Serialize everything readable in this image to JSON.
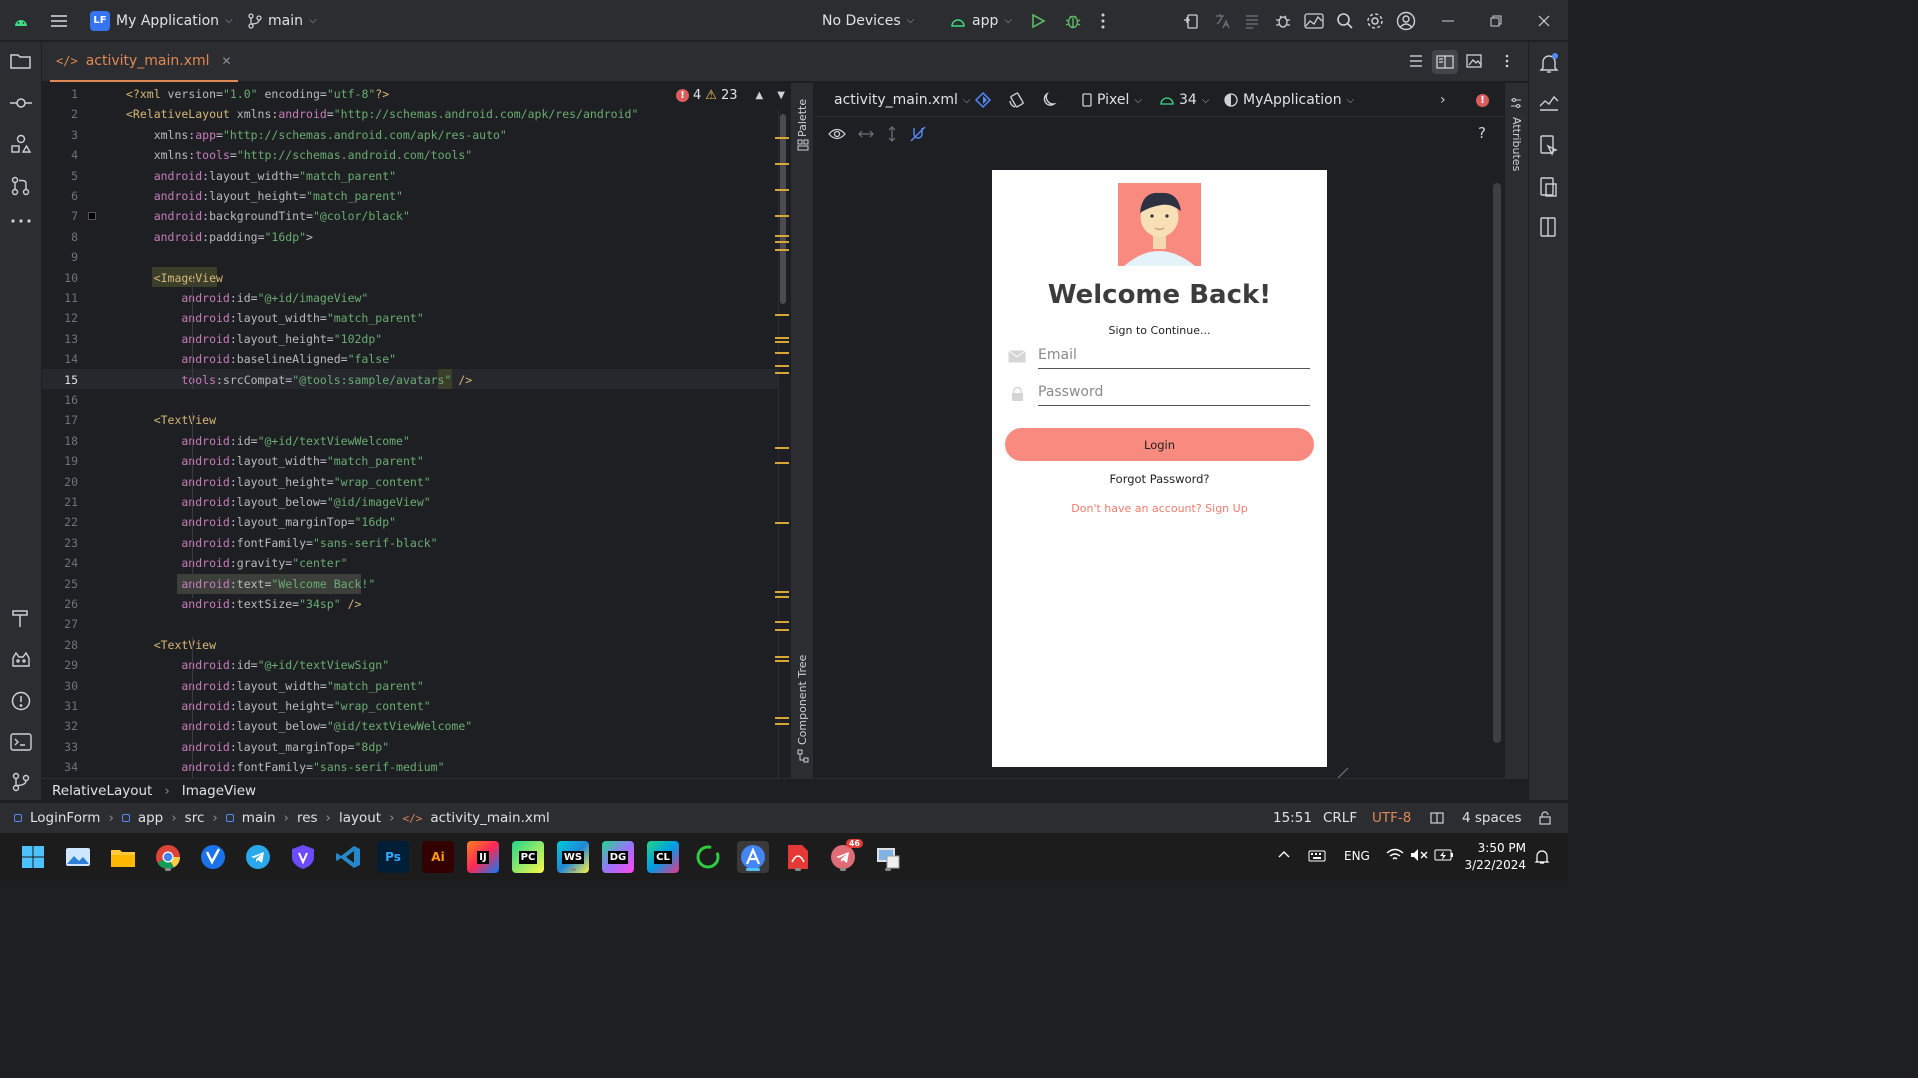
{
  "title_bar": {
    "project_badge": "LF",
    "project_name": "My Application",
    "branch": "main",
    "device": "No Devices",
    "run_config": "app",
    "accent_color": "#3574f0"
  },
  "tabs": [
    {
      "label": "activity_main.xml",
      "icon": "xml-code-icon"
    }
  ],
  "editor": {
    "errors": "4",
    "warnings": "23",
    "lines": [
      {
        "n": "1",
        "parts": [
          [
            "pi",
            "<?xml "
          ],
          [
            "attr",
            "version"
          ],
          [
            "pun",
            "="
          ],
          [
            "str",
            "\"1.0\""
          ],
          [
            "attr",
            " encoding"
          ],
          [
            "pun",
            "="
          ],
          [
            "str",
            "\"utf-8\""
          ],
          [
            "pi",
            "?>"
          ]
        ]
      },
      {
        "n": "2",
        "parts": [
          [
            "tag",
            "<RelativeLayout "
          ],
          [
            "attr",
            "xmlns:"
          ],
          [
            "ns",
            "android"
          ],
          [
            "pun",
            "="
          ],
          [
            "str",
            "\"http://schemas.android.com/apk/res/android\""
          ]
        ]
      },
      {
        "n": "3",
        "parts": [
          [
            "attr",
            "    xmlns:"
          ],
          [
            "ns",
            "app"
          ],
          [
            "pun",
            "="
          ],
          [
            "str",
            "\"http://schemas.android.com/apk/res-auto\""
          ]
        ]
      },
      {
        "n": "4",
        "parts": [
          [
            "attr",
            "    xmlns:"
          ],
          [
            "ns",
            "tools"
          ],
          [
            "pun",
            "="
          ],
          [
            "str",
            "\"http://schemas.android.com/tools\""
          ]
        ]
      },
      {
        "n": "5",
        "parts": [
          [
            "ns",
            "    android"
          ],
          [
            "attr",
            ":layout_width"
          ],
          [
            "pun",
            "="
          ],
          [
            "str",
            "\"match_parent\""
          ]
        ]
      },
      {
        "n": "6",
        "parts": [
          [
            "ns",
            "    android"
          ],
          [
            "attr",
            ":layout_height"
          ],
          [
            "pun",
            "="
          ],
          [
            "str",
            "\"match_parent\""
          ]
        ]
      },
      {
        "n": "7",
        "parts": [
          [
            "ns",
            "    android"
          ],
          [
            "attr",
            ":backgroundTint"
          ],
          [
            "pun",
            "="
          ],
          [
            "str",
            "\"@color/black\""
          ]
        ]
      },
      {
        "n": "8",
        "parts": [
          [
            "ns",
            "    android"
          ],
          [
            "attr",
            ":padding"
          ],
          [
            "pun",
            "="
          ],
          [
            "str",
            "\"16dp\""
          ],
          [
            "pun",
            ">"
          ]
        ]
      },
      {
        "n": "9",
        "parts": []
      },
      {
        "n": "10",
        "parts": [
          [
            "tag",
            "    <ImageView"
          ]
        ]
      },
      {
        "n": "11",
        "parts": [
          [
            "ns",
            "        android"
          ],
          [
            "attr",
            ":id"
          ],
          [
            "pun",
            "="
          ],
          [
            "str",
            "\"@+id/imageView\""
          ]
        ]
      },
      {
        "n": "12",
        "parts": [
          [
            "ns",
            "        android"
          ],
          [
            "attr",
            ":layout_width"
          ],
          [
            "pun",
            "="
          ],
          [
            "str",
            "\"match_parent\""
          ]
        ]
      },
      {
        "n": "13",
        "parts": [
          [
            "ns",
            "        android"
          ],
          [
            "attr",
            ":layout_height"
          ],
          [
            "pun",
            "="
          ],
          [
            "str",
            "\"102dp\""
          ]
        ]
      },
      {
        "n": "14",
        "parts": [
          [
            "ns",
            "        android"
          ],
          [
            "attr",
            ":baselineAligned"
          ],
          [
            "pun",
            "="
          ],
          [
            "str",
            "\"false\""
          ]
        ]
      },
      {
        "n": "15",
        "parts": [
          [
            "ns",
            "        tools"
          ],
          [
            "attr",
            ":srcCompat"
          ],
          [
            "pun",
            "="
          ],
          [
            "str",
            "\"@tools:sample/avatars\""
          ],
          [
            "tag",
            " />"
          ]
        ]
      },
      {
        "n": "16",
        "parts": []
      },
      {
        "n": "17",
        "parts": [
          [
            "tag",
            "    <TextView"
          ]
        ]
      },
      {
        "n": "18",
        "parts": [
          [
            "ns",
            "        android"
          ],
          [
            "attr",
            ":id"
          ],
          [
            "pun",
            "="
          ],
          [
            "str",
            "\"@+id/textViewWelcome\""
          ]
        ]
      },
      {
        "n": "19",
        "parts": [
          [
            "ns",
            "        android"
          ],
          [
            "attr",
            ":layout_width"
          ],
          [
            "pun",
            "="
          ],
          [
            "str",
            "\"match_parent\""
          ]
        ]
      },
      {
        "n": "20",
        "parts": [
          [
            "ns",
            "        android"
          ],
          [
            "attr",
            ":layout_height"
          ],
          [
            "pun",
            "="
          ],
          [
            "str",
            "\"wrap_content\""
          ]
        ]
      },
      {
        "n": "21",
        "parts": [
          [
            "ns",
            "        android"
          ],
          [
            "attr",
            ":layout_below"
          ],
          [
            "pun",
            "="
          ],
          [
            "str",
            "\"@id/imageView\""
          ]
        ]
      },
      {
        "n": "22",
        "parts": [
          [
            "ns",
            "        android"
          ],
          [
            "attr",
            ":layout_marginTop"
          ],
          [
            "pun",
            "="
          ],
          [
            "str",
            "\"16dp\""
          ]
        ]
      },
      {
        "n": "23",
        "parts": [
          [
            "ns",
            "        android"
          ],
          [
            "attr",
            ":fontFamily"
          ],
          [
            "pun",
            "="
          ],
          [
            "str",
            "\"sans-serif-black\""
          ]
        ]
      },
      {
        "n": "24",
        "parts": [
          [
            "ns",
            "        android"
          ],
          [
            "attr",
            ":gravity"
          ],
          [
            "pun",
            "="
          ],
          [
            "str",
            "\"center\""
          ]
        ]
      },
      {
        "n": "25",
        "parts": [
          [
            "ns",
            "        android"
          ],
          [
            "attr",
            ":text"
          ],
          [
            "pun",
            "="
          ],
          [
            "str",
            "\"Welcome Back!\""
          ]
        ]
      },
      {
        "n": "26",
        "parts": [
          [
            "ns",
            "        android"
          ],
          [
            "attr",
            ":textSize"
          ],
          [
            "pun",
            "="
          ],
          [
            "str",
            "\"34sp\""
          ],
          [
            "tag",
            " />"
          ]
        ]
      },
      {
        "n": "27",
        "parts": []
      },
      {
        "n": "28",
        "parts": [
          [
            "tag",
            "    <TextView"
          ]
        ]
      },
      {
        "n": "29",
        "parts": [
          [
            "ns",
            "        android"
          ],
          [
            "attr",
            ":id"
          ],
          [
            "pun",
            "="
          ],
          [
            "str",
            "\"@+id/textViewSign\""
          ]
        ]
      },
      {
        "n": "30",
        "parts": [
          [
            "ns",
            "        android"
          ],
          [
            "attr",
            ":layout_width"
          ],
          [
            "pun",
            "="
          ],
          [
            "str",
            "\"match_parent\""
          ]
        ]
      },
      {
        "n": "31",
        "parts": [
          [
            "ns",
            "        android"
          ],
          [
            "attr",
            ":layout_height"
          ],
          [
            "pun",
            "="
          ],
          [
            "str",
            "\"wrap_content\""
          ]
        ]
      },
      {
        "n": "32",
        "parts": [
          [
            "ns",
            "        android"
          ],
          [
            "attr",
            ":layout_below"
          ],
          [
            "pun",
            "="
          ],
          [
            "str",
            "\"@id/textViewWelcome\""
          ]
        ]
      },
      {
        "n": "33",
        "parts": [
          [
            "ns",
            "        android"
          ],
          [
            "attr",
            ":layout_marginTop"
          ],
          [
            "pun",
            "="
          ],
          [
            "str",
            "\"8dp\""
          ]
        ]
      },
      {
        "n": "34",
        "parts": [
          [
            "ns",
            "        android"
          ],
          [
            "attr",
            ":fontFamily"
          ],
          [
            "pun",
            "="
          ],
          [
            "str",
            "\"sans-serif-medium\""
          ]
        ]
      }
    ]
  },
  "side_tools": {
    "palette": "Palette",
    "component_tree": "Component Tree",
    "attributes": "Attributes"
  },
  "design_toolbar": {
    "file": "activity_main.xml",
    "device": "Pixel",
    "api": "34",
    "theme": "MyApplication",
    "help": "?"
  },
  "preview": {
    "title": "Welcome Back!",
    "subtitle": "Sign to Continue...",
    "email_hint": "Email",
    "password_hint": "Password",
    "login_label": "Login",
    "forgot": "Forgot Password?",
    "signup": "Don't have an account? Sign Up",
    "accent_color": "#f98a80"
  },
  "breadcrumb": [
    "RelativeLayout",
    "ImageView"
  ],
  "status_bar": {
    "path": [
      "LoginForm",
      "app",
      "src",
      "main",
      "res",
      "layout",
      "activity_main.xml"
    ],
    "position": "15:51",
    "line_sep": "CRLF",
    "encoding": "UTF-8",
    "indent": "4 spaces"
  },
  "taskbar": {
    "lang": "ENG",
    "time": "3:50 PM",
    "date": "3/22/2024",
    "telegram_badge": "46",
    "apps": [
      "Ps",
      "Ai",
      "IJ",
      "PC",
      "WS",
      "DG",
      "CL"
    ]
  }
}
